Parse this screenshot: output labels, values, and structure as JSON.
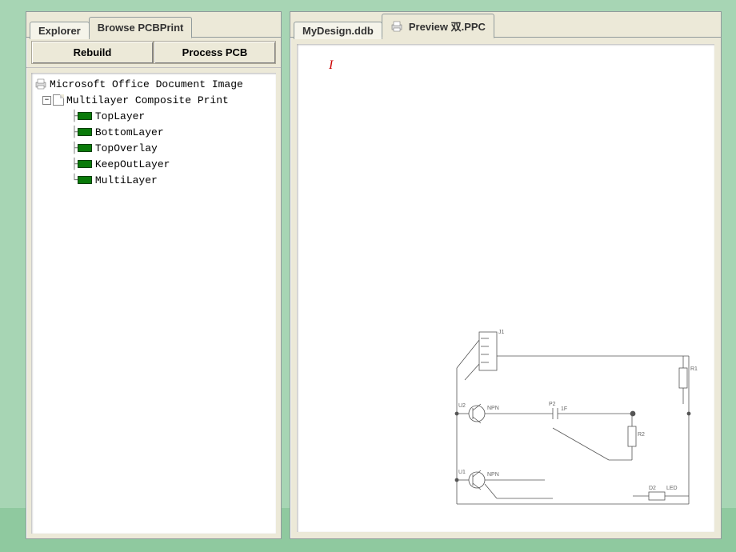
{
  "leftPanel": {
    "tabs": [
      {
        "label": "Explorer",
        "active": false
      },
      {
        "label": "Browse PCBPrint",
        "active": true
      }
    ],
    "buttons": {
      "rebuild": "Rebuild",
      "processPcb": "Process PCB"
    },
    "tree": {
      "root": {
        "label": "Microsoft Office Document Image"
      },
      "composite": {
        "label": "Multilayer Composite Print",
        "expanded": true
      },
      "layers": [
        {
          "label": "TopLayer"
        },
        {
          "label": "BottomLayer"
        },
        {
          "label": "TopOverlay"
        },
        {
          "label": "KeepOutLayer"
        },
        {
          "label": "MultiLayer"
        }
      ]
    }
  },
  "rightPanel": {
    "tabs": [
      {
        "label": "MyDesign.ddb",
        "active": false
      },
      {
        "label": "Preview 双.PPC",
        "active": true,
        "hasIcon": true
      }
    ],
    "cursorMark": "I",
    "circuitLabels": {
      "u2": "U2",
      "u1": "U1",
      "j1": "J1",
      "r1": "R1",
      "p2": "P2",
      "r2": "R2",
      "d2": "D2",
      "led": "LED",
      "npn1": "NPN",
      "npn2": "NPN",
      "cap": "1F"
    }
  }
}
